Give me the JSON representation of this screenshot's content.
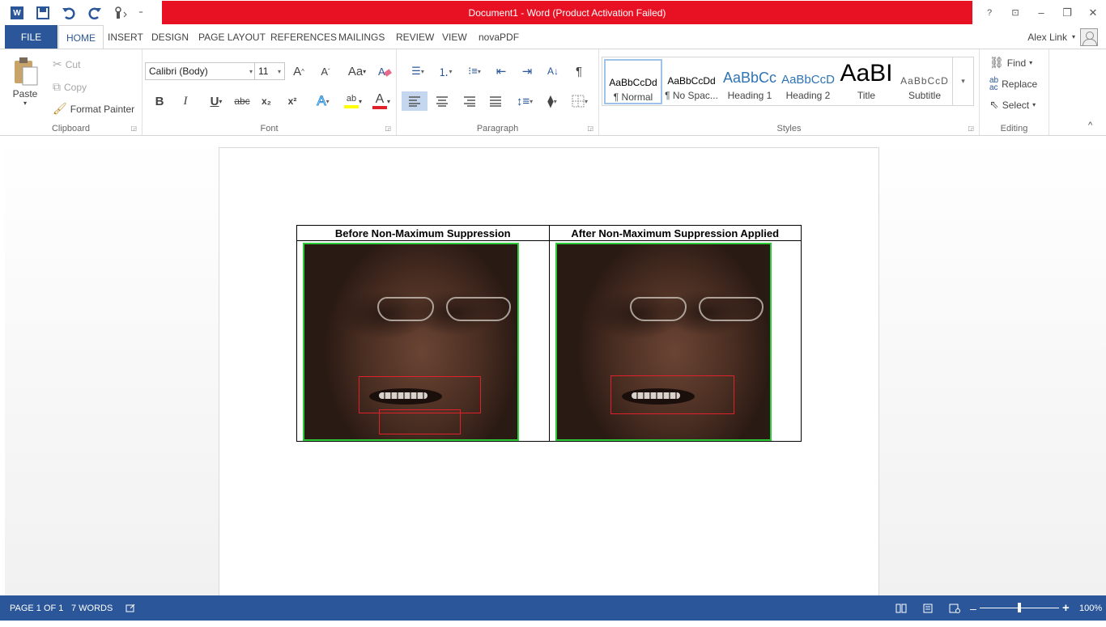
{
  "window": {
    "title": "Document1 -  Word (Product Activation Failed)",
    "controls": {
      "help": "?",
      "ribbon_display": "⊡",
      "minimize": "–",
      "restore": "❐",
      "close": "✕"
    }
  },
  "qat": {
    "word_icon": "W",
    "save_icon": "💾",
    "undo_icon": "↶",
    "redo_icon": "↻",
    "touch_icon": "☝",
    "customize": "⁼"
  },
  "tabs": [
    "FILE",
    "HOME",
    "INSERT",
    "DESIGN",
    "PAGE LAYOUT",
    "REFERENCES",
    "MAILINGS",
    "REVIEW",
    "VIEW",
    "novaPDF"
  ],
  "user": {
    "name": "Alex Link",
    "dropdown": "▾"
  },
  "ribbon": {
    "clipboard": {
      "paste": "Paste",
      "paste_arrow": "▾",
      "cut": "Cut",
      "copy": "Copy",
      "format_painter": "Format Painter",
      "label": "Clipboard"
    },
    "font": {
      "font_name": "Calibri (Body)",
      "font_size": "11",
      "grow": "A",
      "shrink": "A",
      "change_case": "Aa",
      "bold": "B",
      "italic": "I",
      "underline": "U",
      "strike": "abc",
      "subscript": "x₂",
      "superscript": "x²",
      "text_effects": "A",
      "highlight": "ab",
      "font_color": "A",
      "label": "Font"
    },
    "paragraph": {
      "label": "Paragraph",
      "show_marks": "¶",
      "sort": "A↓"
    },
    "styles": {
      "label": "Styles",
      "items": [
        {
          "preview": "AaBbCcDd",
          "name": "¶ Normal"
        },
        {
          "preview": "AaBbCcDd",
          "name": "¶ No Spac..."
        },
        {
          "preview": "AaBbCc",
          "name": "Heading 1"
        },
        {
          "preview": "AaBbCcD",
          "name": "Heading 2"
        },
        {
          "preview": "AaBI",
          "name": "Title"
        },
        {
          "preview": "AaBbCcD",
          "name": "Subtitle"
        }
      ]
    },
    "editing": {
      "find": "Find",
      "replace": "Replace",
      "select": "Select",
      "label": "Editing"
    },
    "collapse": "^"
  },
  "document": {
    "table": {
      "headers": [
        "Before Non-Maximum Suppression",
        "After Non-Maximum Suppression Applied"
      ]
    }
  },
  "status": {
    "page": "PAGE 1 OF 1",
    "words": "7 WORDS",
    "zoom": "100%",
    "zoom_minus": "–",
    "zoom_plus": "+"
  },
  "colors": {
    "word_blue": "#2b579a",
    "activation_red": "#e81123",
    "detection_green": "#2fcc3a",
    "detection_red": "#e0202a"
  }
}
